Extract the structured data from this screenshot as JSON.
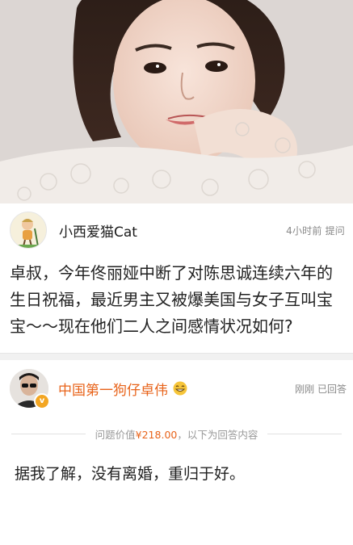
{
  "question": {
    "username": "小西爱猫Cat",
    "time": "4小时前",
    "action": "提问",
    "text": "卓叔，今年佟丽娅中断了对陈思诚连续六年的生日祝福，最近男主又被爆美国与女子互叫宝宝～～现在他们二人之间感情状况如何?"
  },
  "answer": {
    "username": "中国第一狗仔卓伟",
    "time": "刚刚",
    "action": "已回答",
    "value_label": "问题价值",
    "value_amount": "¥218.00",
    "value_suffix": "，以下为回答内容",
    "text": "据我了解，没有离婚，重归于好。"
  },
  "colors": {
    "answerer_name": "#e8631a",
    "price": "#e8631a",
    "meta_gray": "#888888"
  },
  "icons": [
    "woman-photo",
    "cartoon-avatar-icon",
    "answerer-avatar",
    "verified-badge-icon",
    "grin-emoji-icon"
  ]
}
